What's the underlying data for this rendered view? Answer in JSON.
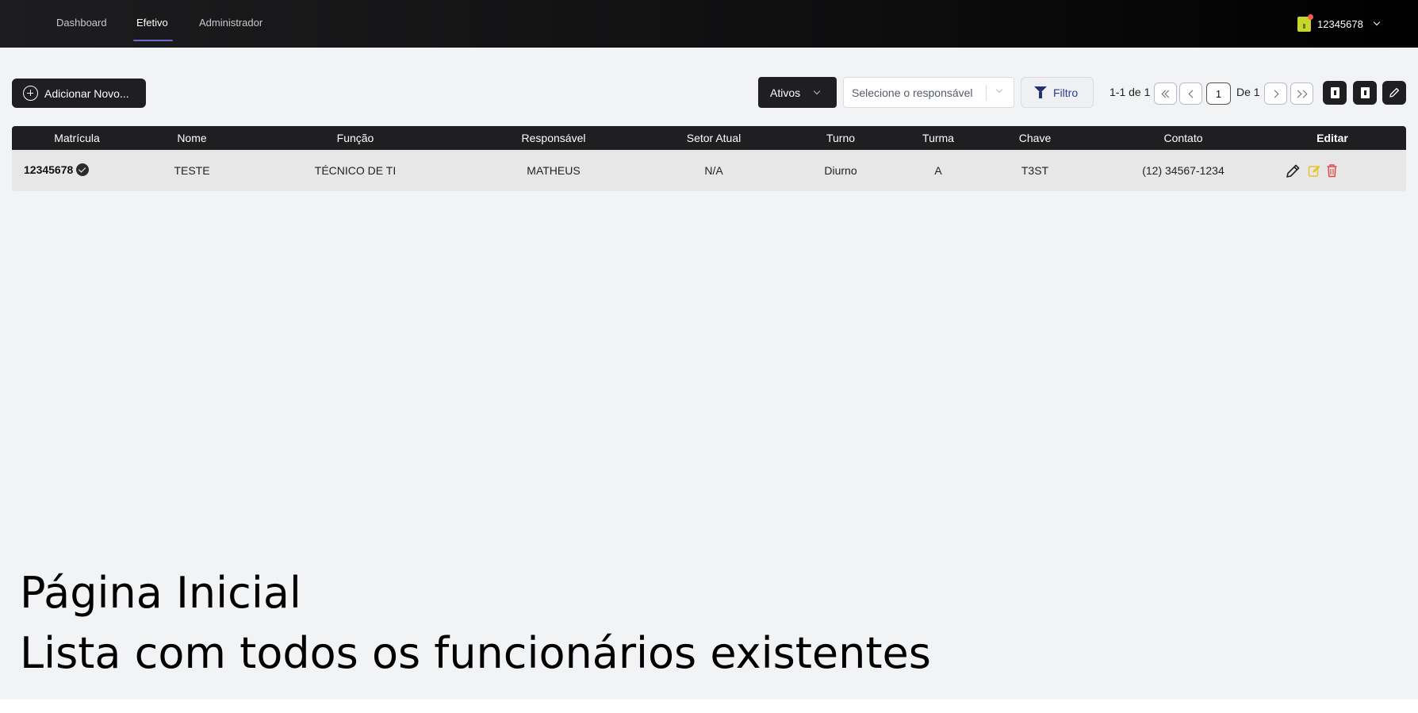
{
  "nav": {
    "tabs": [
      {
        "label": "Dashboard",
        "active": false
      },
      {
        "label": "Efetivo",
        "active": true
      },
      {
        "label": "Administrador",
        "active": false
      }
    ],
    "user": {
      "id": "12345678",
      "avatar_color": "#c6d62a",
      "notification_dot_color": "#ff5a4d"
    }
  },
  "toolbar": {
    "add_label": "Adicionar Novo...",
    "status_value": "Ativos",
    "responsavel_placeholder": "Selecione o responsável",
    "filter_label": "Filtro",
    "pager": {
      "range": "1-1 de 1",
      "current_page": "1",
      "of_label": "De 1"
    }
  },
  "table": {
    "headers": [
      "Matrícula",
      "Nome",
      "Função",
      "Responsável",
      "Setor Atual",
      "Turno",
      "Turma",
      "Chave",
      "Contato",
      "Editar"
    ],
    "rows": [
      {
        "matricula": "12345678",
        "nome": "TESTE",
        "funcao": "TÉCNICO DE TI",
        "responsavel": "MATHEUS",
        "setor": "N/A",
        "turno": "Diurno",
        "turma": "A",
        "chave": "T3ST",
        "contato": "(12) 34567-1234"
      }
    ]
  },
  "caption": {
    "line1": "Página Inicial",
    "line2": "Lista com todos os funcionários existentes"
  },
  "colors": {
    "accent_underline": "#6a68c9",
    "filter_text": "#2f3b8f",
    "edit_icon": "#e8c42a",
    "delete_icon": "#e24b4b"
  }
}
